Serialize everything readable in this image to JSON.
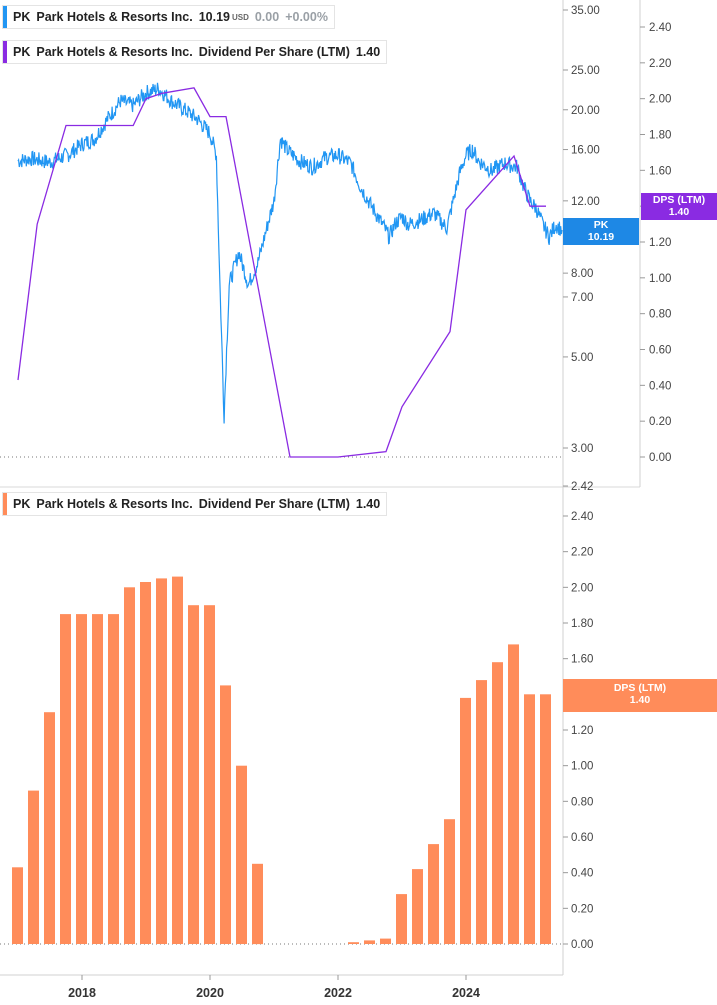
{
  "legends": {
    "price": {
      "ticker": "PK",
      "company": "Park Hotels & Resorts Inc.",
      "value": "10.19",
      "currency": "USD",
      "change": "0.00",
      "change_pct": "+0.00%",
      "color": "#2196f3"
    },
    "dps_top": {
      "ticker": "PK",
      "company": "Park Hotels & Resorts Inc.",
      "metric": "Dividend Per Share (LTM)",
      "value": "1.40",
      "color": "#8a2be2"
    },
    "dps_bottom": {
      "ticker": "PK",
      "company": "Park Hotels & Resorts Inc.",
      "metric": "Dividend Per Share (LTM)",
      "value": "1.40",
      "color": "#ff8c5a"
    }
  },
  "tags": {
    "price": {
      "label": "PK",
      "value": "10.19",
      "color": "#1e88e5"
    },
    "dps_top": {
      "label": "DPS (LTM)",
      "value": "1.40",
      "color": "#8a2be2"
    },
    "dps_bottom": {
      "label": "DPS (LTM)",
      "value": "1.40",
      "color": "#ff8c5a"
    }
  },
  "chart_data": [
    {
      "type": "line",
      "scale": "log",
      "ylim": [
        2.9,
        36
      ],
      "ticks": [
        "35.00",
        "25.00",
        "20.00",
        "16.00",
        "12.00",
        "8.00",
        "7.00",
        "5.00",
        "3.00"
      ],
      "tick_values": [
        35,
        25,
        20,
        16,
        12,
        8,
        7,
        5,
        3
      ],
      "series": [
        {
          "name": "PK",
          "x": [
            2017.0,
            2017.2,
            2017.5,
            2017.8,
            2018.0,
            2018.2,
            2018.4,
            2018.6,
            2018.8,
            2019.0,
            2019.2,
            2019.4,
            2019.6,
            2019.8,
            2020.0,
            2020.1,
            2020.15,
            2020.2,
            2020.22,
            2020.3,
            2020.45,
            2020.6,
            2020.75,
            2020.9,
            2021.0,
            2021.1,
            2021.2,
            2021.4,
            2021.6,
            2021.8,
            2022.0,
            2022.2,
            2022.35,
            2022.5,
            2022.7,
            2022.8,
            2022.9,
            2023.0,
            2023.1,
            2023.3,
            2023.5,
            2023.7,
            2023.8,
            2023.9,
            2024.0,
            2024.1,
            2024.2,
            2024.4,
            2024.6,
            2024.8,
            2024.9,
            2025.0,
            2025.1,
            2025.2,
            2025.3,
            2025.4,
            2025.5
          ],
          "y": [
            15.0,
            15.2,
            14.9,
            15.6,
            16.5,
            17.0,
            19.0,
            21.0,
            20.5,
            22.0,
            22.5,
            21.0,
            20.0,
            19.0,
            17.5,
            15.5,
            8.0,
            4.5,
            3.6,
            7.5,
            9.0,
            7.5,
            8.5,
            10.5,
            12.0,
            17.0,
            16.0,
            15.0,
            14.5,
            15.3,
            15.5,
            14.8,
            13.0,
            11.8,
            10.5,
            9.8,
            10.6,
            11.0,
            10.5,
            10.8,
            11.2,
            10.3,
            12.0,
            14.0,
            15.5,
            16.0,
            15.0,
            14.2,
            14.8,
            14.5,
            13.0,
            12.0,
            11.5,
            10.5,
            9.8,
            10.5,
            10.19
          ]
        }
      ]
    },
    {
      "type": "line",
      "ylim": [
        -0.05,
        2.55
      ],
      "ticks": [
        "2.40",
        "2.20",
        "2.00",
        "1.80",
        "1.60",
        "1.40",
        "1.20",
        "1.00",
        "0.80",
        "0.60",
        "0.40",
        "0.20",
        "0.00"
      ],
      "tick_values": [
        2.4,
        2.2,
        2.0,
        1.8,
        1.6,
        1.4,
        1.2,
        1.0,
        0.8,
        0.6,
        0.4,
        0.2,
        0.0
      ],
      "series": [
        {
          "name": "Dividend Per Share (LTM)",
          "x": [
            2017.0,
            2017.3,
            2017.75,
            2018.0,
            2018.8,
            2019.0,
            2019.25,
            2019.75,
            2020.0,
            2020.25,
            2021.25,
            2022.0,
            2022.75,
            2023.0,
            2023.75,
            2024.0,
            2024.75,
            2025.0,
            2025.25
          ],
          "y": [
            0.43,
            1.3,
            1.85,
            1.85,
            1.85,
            2.0,
            2.03,
            2.06,
            1.9,
            1.9,
            0.0,
            0.0,
            0.03,
            0.28,
            0.7,
            1.38,
            1.68,
            1.4,
            1.4
          ]
        }
      ]
    },
    {
      "type": "bar",
      "ylim": [
        -0.05,
        2.55
      ],
      "ticks": [
        "2.42",
        "2.40",
        "2.20",
        "2.00",
        "1.80",
        "1.60",
        "1.40",
        "1.20",
        "1.00",
        "0.80",
        "0.60",
        "0.40",
        "0.20",
        "0.00"
      ],
      "tick_values": [
        2.42,
        2.4,
        2.2,
        2.0,
        1.8,
        1.6,
        1.4,
        1.2,
        1.0,
        0.8,
        0.6,
        0.4,
        0.2,
        0.0
      ],
      "xticks": [
        "2018",
        "2020",
        "2022",
        "2024"
      ],
      "xtick_values": [
        2018,
        2020,
        2022,
        2024
      ],
      "series": [
        {
          "name": "Dividend Per Share (LTM)",
          "x": [
            2017.0,
            2017.25,
            2017.5,
            2017.75,
            2018.0,
            2018.25,
            2018.5,
            2018.75,
            2019.0,
            2019.25,
            2019.5,
            2019.75,
            2020.0,
            2020.25,
            2020.5,
            2020.75,
            2021.0,
            2022.25,
            2022.5,
            2022.75,
            2023.0,
            2023.25,
            2023.5,
            2023.75,
            2024.0,
            2024.25,
            2024.5,
            2024.75,
            2025.0,
            2025.25
          ],
          "values": [
            0.43,
            0.86,
            1.3,
            1.85,
            1.85,
            1.85,
            1.85,
            2.0,
            2.03,
            2.05,
            2.06,
            1.9,
            1.9,
            1.45,
            1.0,
            0.45,
            0.0,
            0.01,
            0.02,
            0.03,
            0.28,
            0.42,
            0.56,
            0.7,
            1.38,
            1.48,
            1.58,
            1.68,
            1.4,
            1.4
          ]
        }
      ]
    }
  ]
}
